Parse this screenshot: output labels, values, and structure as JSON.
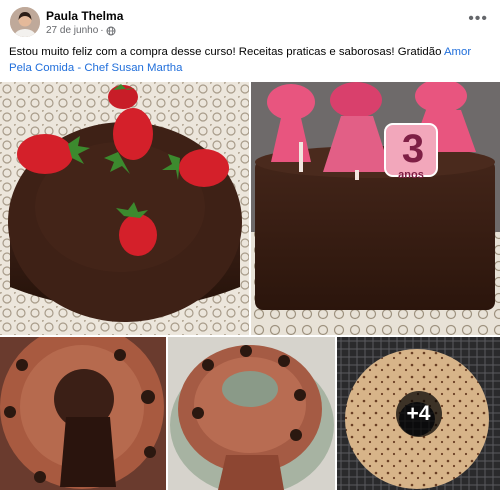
{
  "post": {
    "author": "Paula Thelma",
    "date": "27 de junho",
    "separator": "·",
    "privacy_icon": "globe-icon",
    "more_icon": "more-options-icon",
    "caption_text": "Estou muito feliz com a compra desse curso! Receitas praticas e saborosas! Gratidão ",
    "caption_link": "Amor Pela Comida - Chef Susan Martha"
  },
  "gallery": {
    "more_count": "+4",
    "topper_number": "3",
    "topper_word": "anos"
  },
  "colors": {
    "link": "#216fdb",
    "chocolate": "#3e2116",
    "strawberry": "#d4202a",
    "topper_pink": "#e8557f",
    "cake_crumb": "#b66a4e"
  }
}
